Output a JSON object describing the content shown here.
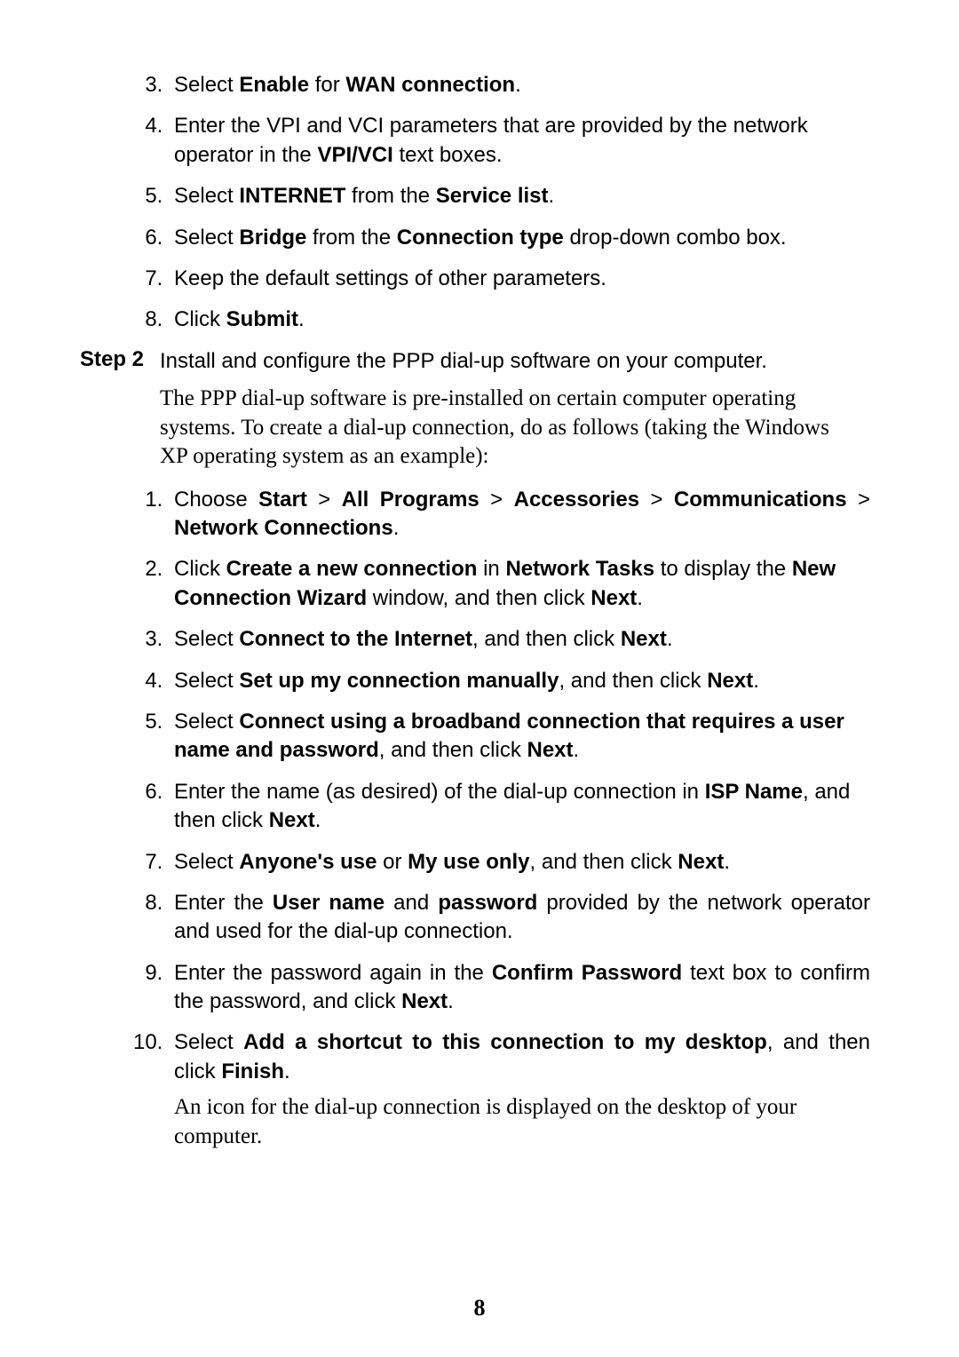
{
  "listA": {
    "i3": {
      "pre": "Select ",
      "b1": "Enable",
      "mid1": " for ",
      "b2": "WAN connection",
      "post": "."
    },
    "i4": {
      "pre": "Enter the VPI and VCI parameters that are provided by the network operator in the ",
      "b1": "VPI/VCI",
      "post": " text boxes."
    },
    "i5": {
      "pre": "Select ",
      "b1": "INTERNET",
      "mid1": " from the ",
      "b2": "Service list",
      "post": "."
    },
    "i6": {
      "pre": "Select ",
      "b1": "Bridge",
      "mid1": " from the ",
      "b2": "Connection type",
      "post": " drop-down combo box."
    },
    "i7": {
      "text": "Keep the default settings of other parameters."
    },
    "i8": {
      "pre": "Click ",
      "b1": "Submit",
      "post": "."
    }
  },
  "step2": {
    "label": "Step 2",
    "text": "Install and configure the PPP dial-up software on your computer."
  },
  "serifIntro": "The PPP dial-up software is pre-installed on certain computer operating systems. To create a dial-up connection, do as follows (taking the Windows XP operating system as an example):",
  "listB": {
    "i1": {
      "pre": "Choose ",
      "b1": "Start",
      "s1": " > ",
      "b2": "All Programs",
      "s2": " > ",
      "b3": "Accessories",
      "s3": " > ",
      "b4": "Communications",
      "s4": " > ",
      "b5": "Network Connections",
      "post": "."
    },
    "i2": {
      "pre": "Click ",
      "b1": "Create a new connection",
      "mid1": " in ",
      "b2": "Network Tasks",
      "mid2": " to display the ",
      "b3": "New Connection Wizard",
      "mid3": " window, and then click ",
      "b4": "Next",
      "post": "."
    },
    "i3": {
      "pre": "Select ",
      "b1": "Connect to the Internet",
      "mid1": ", and then click ",
      "b2": "Next",
      "post": "."
    },
    "i4": {
      "pre": "Select ",
      "b1": "Set up my connection manually",
      "mid1": ", and then click ",
      "b2": "Next",
      "post": "."
    },
    "i5": {
      "pre": "Select ",
      "b1": "Connect using a broadband connection that requires a user name and password",
      "mid1": ", and then click ",
      "b2": "Next",
      "post": "."
    },
    "i6": {
      "pre": "Enter the name (as desired) of the dial-up connection in ",
      "b1": "ISP Name",
      "mid1": ", and then click ",
      "b2": "Next",
      "post": "."
    },
    "i7": {
      "pre": "Select ",
      "b1": "Anyone's use",
      "mid1": " or ",
      "b2": "My use only",
      "mid2": ", and then click ",
      "b3": "Next",
      "post": "."
    },
    "i8": {
      "pre": "Enter the ",
      "b1": "User name",
      "mid1": " and ",
      "b2": "password",
      "post": " provided by the network operator and used for the dial-up connection."
    },
    "i9": {
      "pre": "Enter the password again in the ",
      "b1": "Confirm Password",
      "mid1": " text box to confirm the password, and click ",
      "b2": "Next",
      "post": "."
    },
    "i10": {
      "pre": "Select ",
      "b1": "Add a shortcut to this connection to my desktop",
      "mid1": ", and then click ",
      "b2": "Finish",
      "post": ".",
      "after": "An icon for the dial-up connection is displayed on the desktop of your computer."
    }
  },
  "pageNumber": "8"
}
